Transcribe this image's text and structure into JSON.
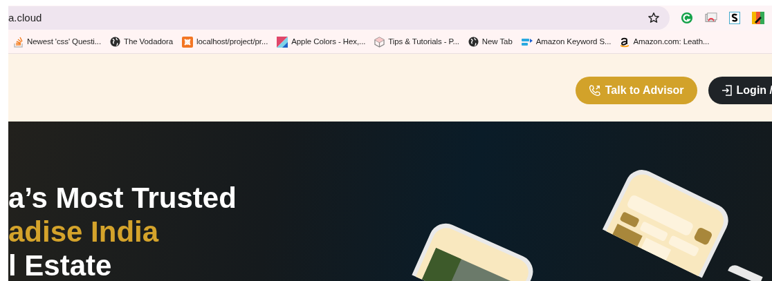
{
  "browser": {
    "address": "a.cloud",
    "bookmarks": [
      {
        "label": "Newest 'css' Questi..."
      },
      {
        "label": "The Vodadora"
      },
      {
        "label": "localhost/project/pr..."
      },
      {
        "label": "Apple Colors - Hex,..."
      },
      {
        "label": "Tips & Tutorials - P..."
      },
      {
        "label": "New Tab"
      },
      {
        "label": "Amazon Keyword S..."
      },
      {
        "label": "Amazon.com: Leath..."
      }
    ]
  },
  "header": {
    "buttons": [
      {
        "label": "Talk to Advisor",
        "kind": "accent"
      },
      {
        "label": "Login /",
        "kind": "dark"
      }
    ]
  },
  "hero": {
    "lines": [
      {
        "text": "a’s Most Trusted",
        "kind": "plain"
      },
      {
        "text": "adise India",
        "kind": "accent"
      },
      {
        "text": "l Estate",
        "kind": "plain"
      }
    ]
  }
}
